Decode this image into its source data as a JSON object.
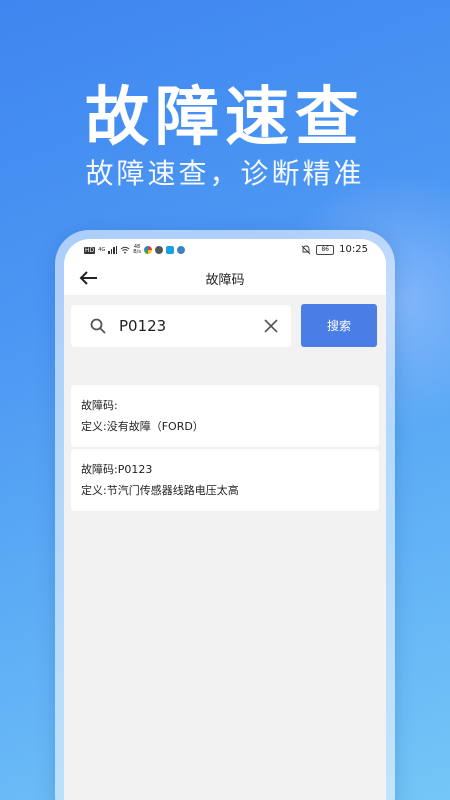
{
  "promo": {
    "headline": "故障速查",
    "subline": "故障速查，诊断精准"
  },
  "statusbar": {
    "hd_label": "HD",
    "network_label": "4G",
    "speed_value": "48",
    "speed_unit": "B/s",
    "battery": "86",
    "time": "10:25"
  },
  "titlebar": {
    "title": "故障码"
  },
  "search": {
    "value": "P0123",
    "placeholder": "",
    "button_label": "搜索"
  },
  "results": [
    {
      "code_line": "故障码:",
      "definition_line": "定义:没有故障（FORD）"
    },
    {
      "code_line": "故障码:P0123",
      "definition_line": "定义:节汽门传感器线路电压太高"
    }
  ],
  "colors": {
    "accent": "#4a7ee6",
    "screen_bg": "#f2f2f2"
  }
}
